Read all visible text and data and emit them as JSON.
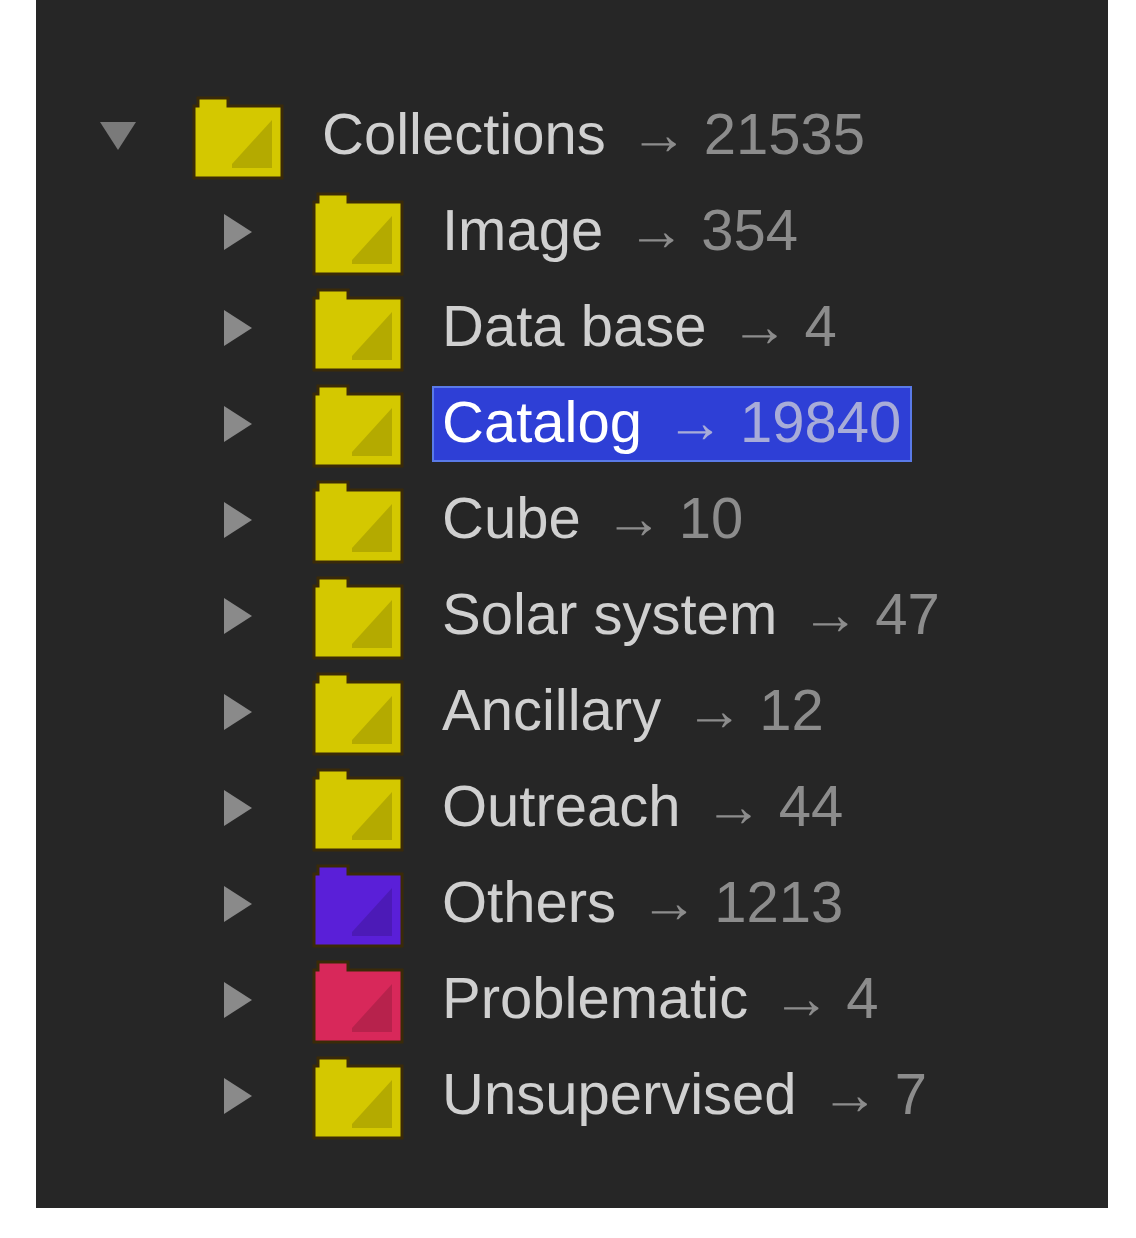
{
  "tree": {
    "label": "Collections",
    "count": "→ 21535",
    "expanded": true,
    "selected": false,
    "color": "#d4c800",
    "children": [
      {
        "label": "Image",
        "count": "→ 354",
        "expanded": false,
        "selected": false,
        "color": "#d4c800"
      },
      {
        "label": "Data base",
        "count": "→ 4",
        "expanded": false,
        "selected": false,
        "color": "#d4c800"
      },
      {
        "label": "Catalog",
        "count": "→ 19840",
        "expanded": false,
        "selected": true,
        "color": "#d4c800"
      },
      {
        "label": "Cube",
        "count": "→ 10",
        "expanded": false,
        "selected": false,
        "color": "#d4c800"
      },
      {
        "label": "Solar system",
        "count": "→ 47",
        "expanded": false,
        "selected": false,
        "color": "#d4c800"
      },
      {
        "label": "Ancillary",
        "count": "→ 12",
        "expanded": false,
        "selected": false,
        "color": "#d4c800"
      },
      {
        "label": "Outreach",
        "count": "→ 44",
        "expanded": false,
        "selected": false,
        "color": "#d4c800"
      },
      {
        "label": "Others",
        "count": "→ 1213",
        "expanded": false,
        "selected": false,
        "color": "#5a1fd8"
      },
      {
        "label": "Problematic",
        "count": "→ 4",
        "expanded": false,
        "selected": false,
        "color": "#d8285a"
      },
      {
        "label": "Unsupervised",
        "count": "→ 7",
        "expanded": false,
        "selected": false,
        "color": "#d4c800"
      }
    ]
  }
}
